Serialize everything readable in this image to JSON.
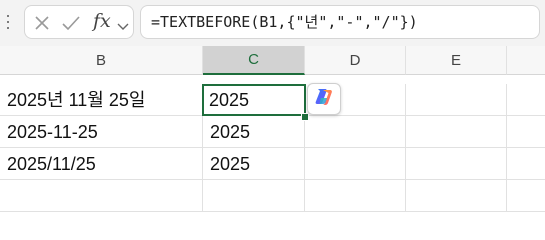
{
  "formula_bar": {
    "cancel_icon": "x-icon",
    "enter_icon": "check-icon",
    "function_label": "fx",
    "function_menu_icon": "chevron-down-icon",
    "formula": "=TEXTBEFORE(B1,{\"년\",\"-\",\"/\"})"
  },
  "columns": [
    {
      "label": "B"
    },
    {
      "label": "C"
    },
    {
      "label": "D"
    },
    {
      "label": "E"
    }
  ],
  "rows": [
    {
      "b": "2025년 11월 25일",
      "c": "2025"
    },
    {
      "b": "2025-11-25",
      "c": "2025"
    },
    {
      "b": "2025/11/25",
      "c": "2025"
    },
    {
      "b": "",
      "c": ""
    }
  ],
  "active_cell": "C1",
  "copilot_icon": "copilot-icon",
  "colors": {
    "accent": "#1e6e3c",
    "grid": "#e1e1e1",
    "header_bg": "#f7f7f7",
    "selected_header_bg": "#d2d2d2"
  }
}
